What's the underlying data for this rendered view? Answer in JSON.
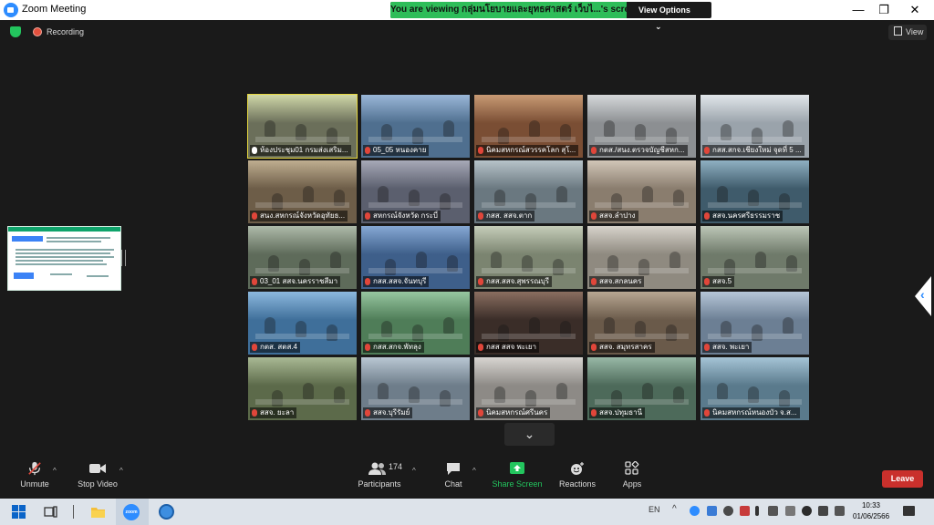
{
  "window": {
    "title": "Zoom Meeting",
    "minimize": "—",
    "restore": "❐",
    "close": "✕"
  },
  "banner": {
    "viewing_text": "You are viewing กลุ่มนโยบายและยุทธศาสตร์ เว็บไ...'s screen",
    "view_options_label": "View Options",
    "view_options_caret": "⌄"
  },
  "topbar": {
    "recording_label": "Recording",
    "view_label": "View"
  },
  "tiles": [
    {
      "name": "ห้องประชุม01 กรมส่งเสริม...",
      "mic": "white",
      "active": true,
      "bg": "#6b6f5a",
      "accent": "#cfd7a8"
    },
    {
      "name": "05_05 หนองคาย",
      "mic": "red",
      "active": false,
      "bg": "#4f6f8f",
      "accent": "#9ab7d8"
    },
    {
      "name": "นิคมสหกรณ์สวรรคโลก สุโ...",
      "mic": "red",
      "active": false,
      "bg": "#7a4e34",
      "accent": "#c89a74"
    },
    {
      "name": "กตส./สนง.ตรวจบัญชีสหก...",
      "mic": "red",
      "active": false,
      "bg": "#8c8f92",
      "accent": "#d5d8da"
    },
    {
      "name": "กสส.สกจ.เชียงใหม่ จุดที่ 5 ...",
      "mic": "red",
      "active": false,
      "bg": "#9aa3ab",
      "accent": "#e1e6ea"
    },
    {
      "name": "สนง.สหกรณ์จังหวัดอุทัยธ...",
      "mic": "red",
      "active": false,
      "bg": "#6d5d48",
      "accent": "#bfae90"
    },
    {
      "name": "สหกรณ์จังหวัด กระบี่",
      "mic": "red",
      "active": false,
      "bg": "#5b5f6e",
      "accent": "#a7a9b7"
    },
    {
      "name": "กสส. สสจ.ตาก",
      "mic": "red",
      "active": false,
      "bg": "#6a7880",
      "accent": "#b7c3c9"
    },
    {
      "name": "สสจ.ลำปาง",
      "mic": "red",
      "active": false,
      "bg": "#8a7d6e",
      "accent": "#d1c6b8"
    },
    {
      "name": "สสจ.นครศรีธรรมราช",
      "mic": "red",
      "active": false,
      "bg": "#3f5b6b",
      "accent": "#8fb0c2"
    },
    {
      "name": "03_01 สสจ.นครราชสีมา",
      "mic": "red",
      "active": false,
      "bg": "#5e6b5a",
      "accent": "#aebaa9"
    },
    {
      "name": "กสส.สสจ.จันทบุรี",
      "mic": "red",
      "active": false,
      "bg": "#3e5f8a",
      "accent": "#86a8d4"
    },
    {
      "name": "กสส.สสจ.สุพรรณบุรี",
      "mic": "red",
      "active": false,
      "bg": "#7b8470",
      "accent": "#c5cdb9"
    },
    {
      "name": "สสจ.สกลนคร",
      "mic": "red",
      "active": false,
      "bg": "#8f8a80",
      "accent": "#d7d3cb"
    },
    {
      "name": "สสจ.5",
      "mic": "red",
      "active": false,
      "bg": "#6f7a6a",
      "accent": "#bcc6b7"
    },
    {
      "name": "กตส. สตส.4",
      "mic": "red",
      "active": false,
      "bg": "#3f6f9a",
      "accent": "#8cb8de"
    },
    {
      "name": "กสส.สกจ.พัทลุง",
      "mic": "red",
      "active": false,
      "bg": "#4f7d58",
      "accent": "#97c6a0"
    },
    {
      "name": "กสส สสจ พะเยา",
      "mic": "red",
      "active": false,
      "bg": "#3a2d28",
      "accent": "#8a6e60"
    },
    {
      "name": "สสจ. สมุทรสาคร",
      "mic": "red",
      "active": false,
      "bg": "#6a5a4a",
      "accent": "#b8a792"
    },
    {
      "name": "สสจ. พะเยา",
      "mic": "red",
      "active": false,
      "bg": "#6c7f94",
      "accent": "#b6c6d8"
    },
    {
      "name": "สสจ. ยะลา",
      "mic": "red",
      "active": false,
      "bg": "#5c6a4a",
      "accent": "#a9b994"
    },
    {
      "name": "สสจ.บุรีรัมย์",
      "mic": "red",
      "active": false,
      "bg": "#6e7d8a",
      "accent": "#b9c7d3"
    },
    {
      "name": "นิคมสหกรณ์ศรีนคร",
      "mic": "red",
      "active": false,
      "bg": "#8d8a86",
      "accent": "#d8d5d1"
    },
    {
      "name": "สสจ.ปทุมธานี",
      "mic": "red",
      "active": false,
      "bg": "#4d6a5a",
      "accent": "#98b8a6"
    },
    {
      "name": "นิคมสหกรณ์หนองบัว จ.ส...",
      "mic": "red",
      "active": false,
      "bg": "#5a7a8c",
      "accent": "#a5c4d6"
    }
  ],
  "toolbar": {
    "unmute_label": "Unmute",
    "stop_video_label": "Stop Video",
    "participants_label": "Participants",
    "participants_count": "174",
    "chat_label": "Chat",
    "share_screen_label": "Share Screen",
    "reactions_label": "Reactions",
    "apps_label": "Apps",
    "leave_label": "Leave",
    "caret": "^"
  },
  "taskbar": {
    "language": "EN",
    "time": "10:33",
    "date": "01/06/2566"
  },
  "colors": {
    "zoom_blue": "#2d8cff",
    "banner_green": "#2ebd59",
    "share_green": "#23c55e",
    "leave_red": "#c9302c",
    "active_speaker": "#e5d63f"
  }
}
